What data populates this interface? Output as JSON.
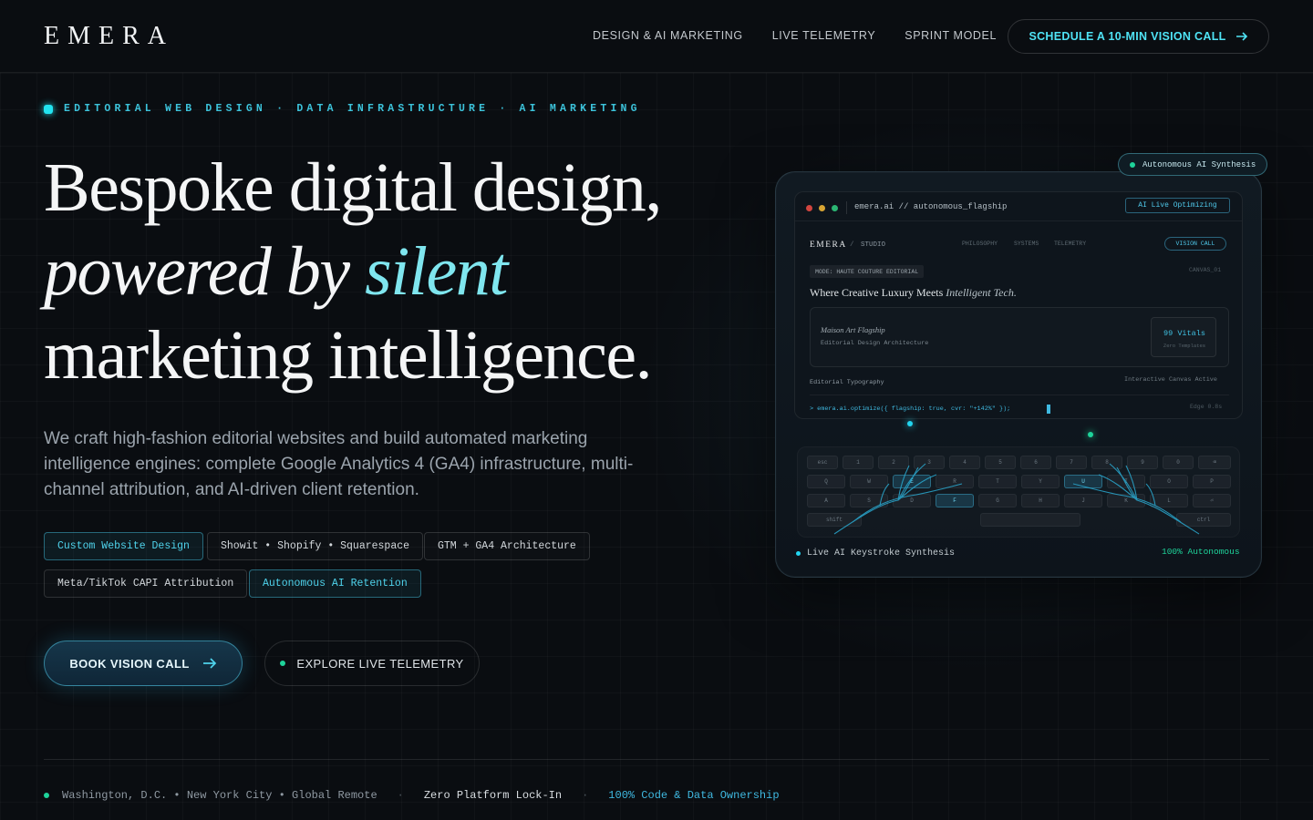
{
  "brand": {
    "logo": "EMERA"
  },
  "nav": {
    "items": [
      "DESIGN & AI MARKETING",
      "LIVE TELEMETRY",
      "SPRINT MODEL"
    ],
    "cta_label": "SCHEDULE A 10-MIN VISION CALL"
  },
  "hero": {
    "eyebrow": "EDITORIAL WEB DESIGN · DATA INFRASTRUCTURE · AI MARKETING",
    "headline": {
      "line1": "Bespoke digital design,",
      "line2a": "powered by ",
      "line2b": "silent",
      "line3": "marketing intelligence."
    },
    "lede": "We craft high-fashion editorial websites and build automated marketing intelligence engines: complete Google Analytics 4 (GA4) infrastructure, multi-channel attribution, and AI-driven client retention.",
    "tags": [
      {
        "label": "Custom Website Design",
        "active": true
      },
      {
        "label": "Showit • Shopify • Squarespace",
        "active": false
      },
      {
        "label": "GTM + GA4 Architecture",
        "active": false
      },
      {
        "label": "Meta/TikTok CAPI Attribution",
        "active": false
      },
      {
        "label": "Autonomous AI Retention",
        "active": true
      }
    ],
    "primary_button": "BOOK VISION CALL",
    "secondary_button": "EXPLORE LIVE TELEMETRY"
  },
  "footer": {
    "locations": "Washington, D.C. • New York City • Global Remote",
    "lockin": "Zero Platform Lock-In",
    "ownership": "100% Code & Data Ownership"
  },
  "mockup": {
    "badge": "Autonomous AI Synthesis",
    "url": "emera.ai // autonomous_flagship",
    "optimizing": "AI Live Optimizing",
    "site_logo": "EMERA",
    "site_section": "STUDIO",
    "site_nav": [
      "PHILOSOPHY",
      "SYSTEMS",
      "TELEMETRY"
    ],
    "site_cta": "VISION CALL",
    "mode": "MODE: HAUTE COUTURE EDITORIAL",
    "canvas": "CANVAS_01",
    "headline_a": "Where Creative Luxury Meets ",
    "headline_b": "Intelligent Tech.",
    "card_title": "Maison Art Flagship",
    "card_sub": "Editorial Design Architecture",
    "vitals": "99 Vitals",
    "vitals_sub": "Zero Templates",
    "typo_label": "Editorial Typography",
    "canvas_label": "Interactive Canvas Active",
    "command": "> emera.ai.optimize({ flagship: true, cvr: \"+142%\" });",
    "edge": "Edge 0.8s",
    "status_left": "Live AI Keystroke Synthesis",
    "status_right": "100% Autonomous",
    "keys": {
      "row1": [
        "esc",
        "1",
        "2",
        "3",
        "4",
        "5",
        "6",
        "7",
        "8",
        "9",
        "0",
        "⌫"
      ],
      "row2": [
        "Q",
        "W",
        "E",
        "R",
        "T",
        "Y",
        "U",
        "I",
        "O",
        "P"
      ],
      "row3": [
        "A",
        "S",
        "D",
        "F",
        "G",
        "H",
        "J",
        "K",
        "L",
        "⏎"
      ],
      "row4": [
        "shift",
        "ctrl"
      ]
    }
  },
  "colors": {
    "background": "#0a0d11",
    "accent_cyan": "#4fe3f5",
    "status_green": "#1ed39a"
  }
}
